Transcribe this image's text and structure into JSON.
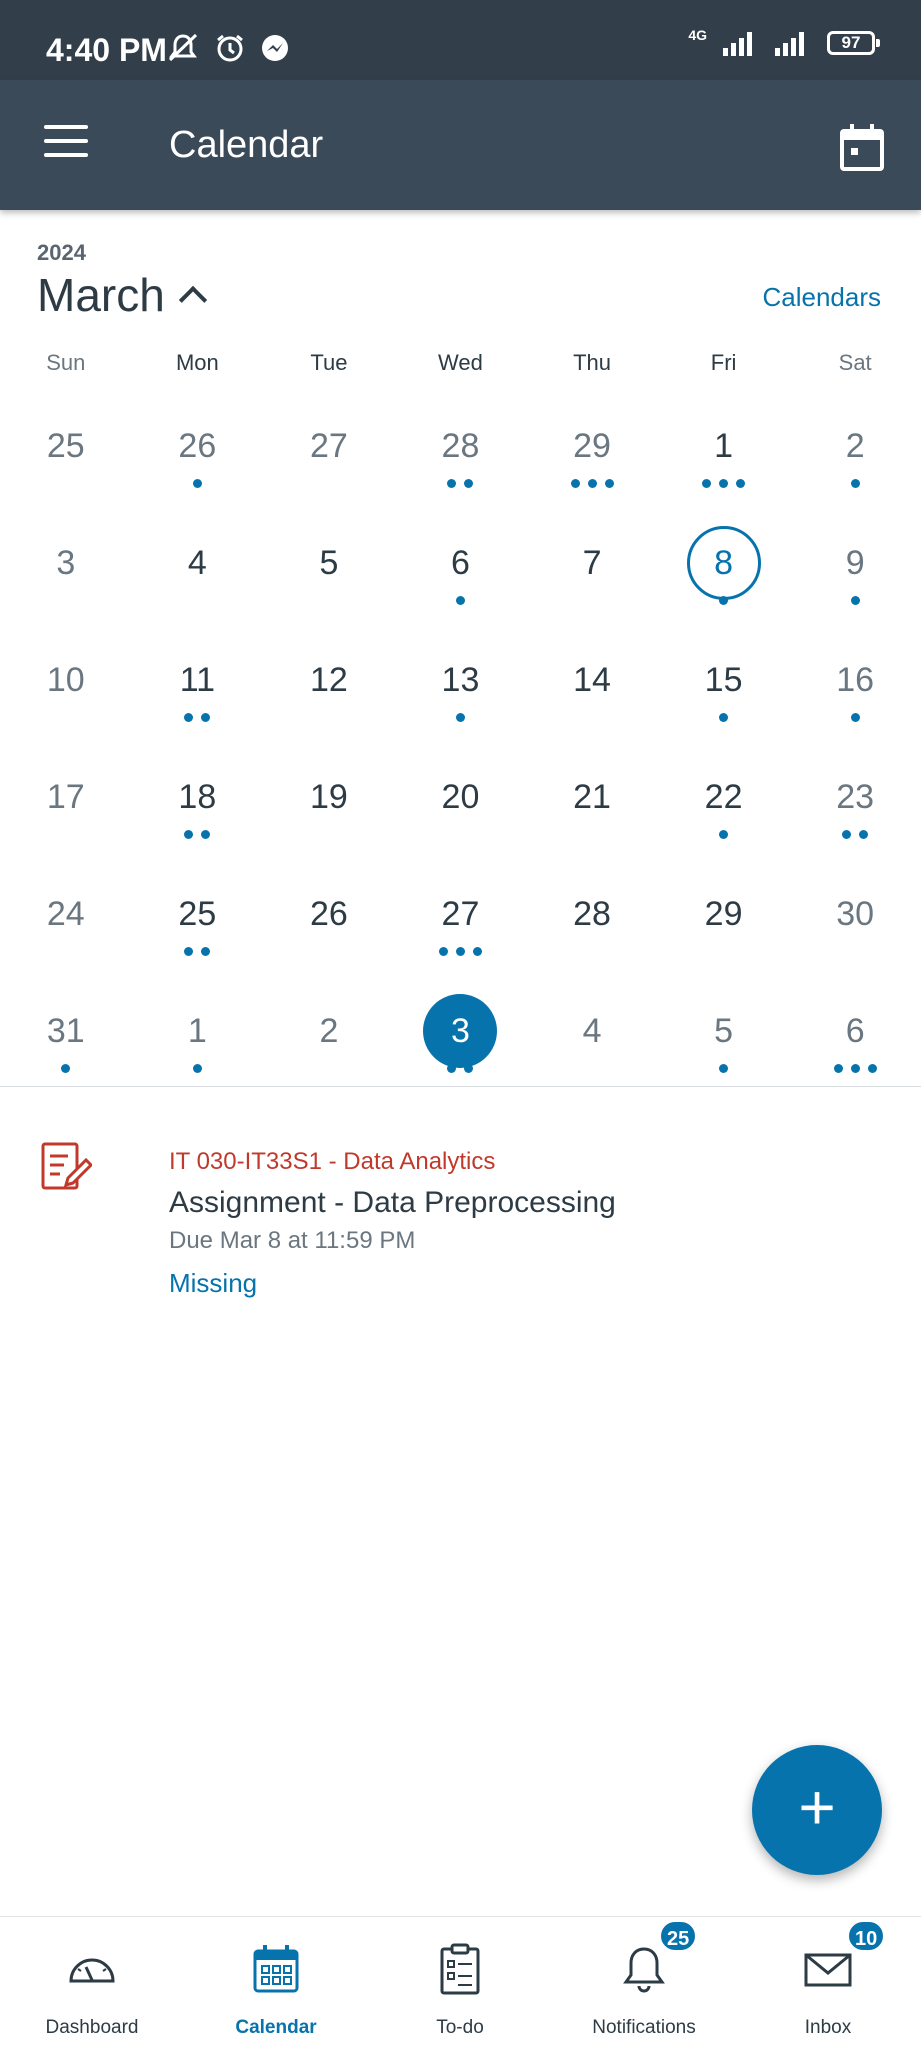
{
  "status_bar": {
    "time": "4:40 PM",
    "network": "4G",
    "battery": "97"
  },
  "app_bar": {
    "title": "Calendar"
  },
  "calendar": {
    "year": "2024",
    "month": "March",
    "calendars_link": "Calendars",
    "weekdays": [
      "Sun",
      "Mon",
      "Tue",
      "Wed",
      "Thu",
      "Fri",
      "Sat"
    ],
    "days": [
      {
        "n": "25",
        "muted": true,
        "dots": 0
      },
      {
        "n": "26",
        "muted": true,
        "dots": 1
      },
      {
        "n": "27",
        "muted": true,
        "dots": 0
      },
      {
        "n": "28",
        "muted": true,
        "dots": 2
      },
      {
        "n": "29",
        "muted": true,
        "dots": 3
      },
      {
        "n": "1",
        "dots": 3
      },
      {
        "n": "2",
        "muted": true,
        "dots": 1
      },
      {
        "n": "3",
        "muted": true,
        "dots": 0
      },
      {
        "n": "4",
        "dots": 0
      },
      {
        "n": "5",
        "dots": 0
      },
      {
        "n": "6",
        "dots": 1
      },
      {
        "n": "7",
        "dots": 0
      },
      {
        "n": "8",
        "today": true,
        "dots": 1
      },
      {
        "n": "9",
        "muted": true,
        "dots": 1
      },
      {
        "n": "10",
        "muted": true,
        "dots": 0
      },
      {
        "n": "11",
        "dots": 2
      },
      {
        "n": "12",
        "dots": 0
      },
      {
        "n": "13",
        "dots": 1
      },
      {
        "n": "14",
        "dots": 0
      },
      {
        "n": "15",
        "dots": 1
      },
      {
        "n": "16",
        "muted": true,
        "dots": 1
      },
      {
        "n": "17",
        "muted": true,
        "dots": 0
      },
      {
        "n": "18",
        "dots": 2
      },
      {
        "n": "19",
        "dots": 0
      },
      {
        "n": "20",
        "dots": 0
      },
      {
        "n": "21",
        "dots": 0
      },
      {
        "n": "22",
        "dots": 1
      },
      {
        "n": "23",
        "muted": true,
        "dots": 2
      },
      {
        "n": "24",
        "muted": true,
        "dots": 0
      },
      {
        "n": "25",
        "dots": 2
      },
      {
        "n": "26",
        "dots": 0
      },
      {
        "n": "27",
        "dots": 3
      },
      {
        "n": "28",
        "dots": 0
      },
      {
        "n": "29",
        "dots": 0
      },
      {
        "n": "30",
        "muted": true,
        "dots": 0
      },
      {
        "n": "31",
        "muted": true,
        "dots": 1
      },
      {
        "n": "1",
        "muted": true,
        "dots": 1
      },
      {
        "n": "2",
        "muted": true,
        "dots": 0
      },
      {
        "n": "3",
        "selected": true,
        "dots": 2
      },
      {
        "n": "4",
        "muted": true,
        "dots": 0
      },
      {
        "n": "5",
        "muted": true,
        "dots": 1
      },
      {
        "n": "6",
        "muted": true,
        "dots": 3
      }
    ]
  },
  "event": {
    "course": "IT 030-IT33S1 - Data Analytics",
    "title": "Assignment - Data Preprocessing",
    "due": "Due Mar 8 at 11:59 PM",
    "status": "Missing"
  },
  "fab": {
    "symbol": "+"
  },
  "bottom_nav": {
    "items": [
      {
        "label": "Dashboard",
        "icon": "dashboard-icon"
      },
      {
        "label": "Calendar",
        "icon": "calendar-icon",
        "active": true
      },
      {
        "label": "To-do",
        "icon": "todo-clipboard-icon"
      },
      {
        "label": "Notifications",
        "icon": "bell-icon",
        "badge": "25"
      },
      {
        "label": "Inbox",
        "icon": "mail-icon",
        "badge": "10"
      }
    ]
  },
  "colors": {
    "accent": "#0773ac",
    "header": "#3b4a59",
    "status_bar": "#323f4a",
    "course_red": "#c0392b"
  }
}
